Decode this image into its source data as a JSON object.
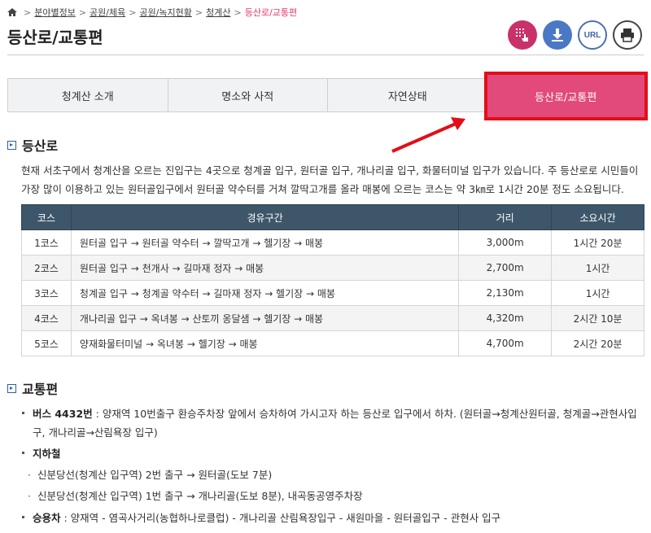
{
  "breadcrumb": [
    "분야별정보",
    "공원/체육",
    "공원/녹지현황",
    "청계산",
    "등산로/교통편"
  ],
  "page_title": "등산로/교통편",
  "tools": {
    "url_label": "URL"
  },
  "tabs": [
    {
      "label": "청계산 소개",
      "active": false
    },
    {
      "label": "명소와 사적",
      "active": false
    },
    {
      "label": "자연상태",
      "active": false
    },
    {
      "label": "등산로/교통편",
      "active": true
    }
  ],
  "trail": {
    "heading": "등산로",
    "intro": "현재 서초구에서 청계산을 오르는 진입구는 4곳으로 청계골 입구, 원터골 입구, 개나리골 입구, 화물터미널 입구가 있습니다. 주 등산로로 시민들이 가장 많이 이용하고 있는 원터골입구에서 원터골 약수터를 거쳐 깔딱고개를 올라 매봉에 오르는 코스는 약 3㎞로 1시간 20분 정도 소요됩니다.",
    "columns": [
      "코스",
      "경유구간",
      "거리",
      "소요시간"
    ],
    "rows": [
      [
        "1코스",
        "원터골 입구 → 원터골 약수터 → 깔딱고개 → 헬기장 → 매봉",
        "3,000m",
        "1시간 20분"
      ],
      [
        "2코스",
        "원터골 입구 → 천개사 → 길마재 정자 → 매봉",
        "2,700m",
        "1시간"
      ],
      [
        "3코스",
        "청계골 입구 → 청계골 약수터 → 길마재 정자 → 헬기장 → 매봉",
        "2,130m",
        "1시간"
      ],
      [
        "4코스",
        "개나리골 입구 → 옥녀봉 → 산토끼 옹달샘 → 헬기장 → 매봉",
        "4,320m",
        "2시간 10분"
      ],
      [
        "5코스",
        "양재화물터미널 → 옥녀봉 → 헬기장 → 매봉",
        "4,700m",
        "2시간 20분"
      ]
    ]
  },
  "transit": {
    "heading": "교통편",
    "bus_label": "버스 4432번",
    "bus_text": " : 양재역 10번출구 환승주차장 앞에서 승차하여 가시고자 하는 등산로 입구에서 하차. (원터골→청계산원터골, 청계골→관현사입구, 개나리골→산림욕장 입구)",
    "subway_label": "지하철",
    "subway_items": [
      "신분당선(청계산 입구역) 2번 출구 → 원터골(도보 7분)",
      "신분당선(청계산 입구역) 1번 출구 → 개나리골(도보 8분), 내곡동공영주차장"
    ],
    "car_label": "승용차",
    "car_text": " : 양재역 - 염곡사거리(농협하나로클럽) - 개나리골 산림욕장입구 - 새원마을 - 원터골입구 - 관현사 입구"
  }
}
